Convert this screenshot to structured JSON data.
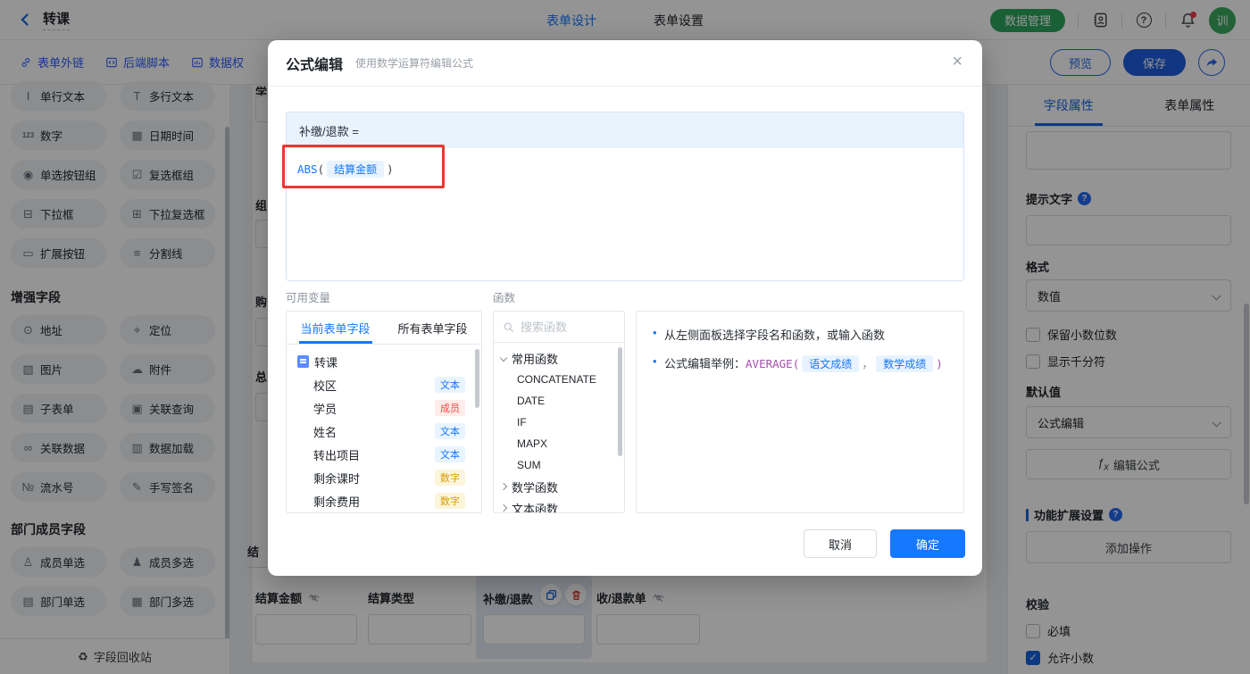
{
  "topbar": {
    "title": "转课",
    "tab_design": "表单设计",
    "tab_settings": "表单设置",
    "data_manage": "数据管理",
    "avatar": "训"
  },
  "toolbar": {
    "form_link": "表单外链",
    "backend_script": "后端脚本",
    "data_perm": "数据权",
    "preview": "预览",
    "save": "保存"
  },
  "sidebar": {
    "basic": [
      {
        "label": "单行文本"
      },
      {
        "label": "多行文本"
      },
      {
        "label": "数字"
      },
      {
        "label": "日期时间"
      },
      {
        "label": "单选按钮组"
      },
      {
        "label": "复选框组"
      },
      {
        "label": "下拉框"
      },
      {
        "label": "下拉复选框"
      },
      {
        "label": "扩展按钮"
      },
      {
        "label": "分割线"
      }
    ],
    "section_enhanced": "增强字段",
    "enhanced": [
      {
        "label": "地址"
      },
      {
        "label": "定位"
      },
      {
        "label": "图片"
      },
      {
        "label": "附件"
      },
      {
        "label": "子表单"
      },
      {
        "label": "关联查询"
      },
      {
        "label": "关联数据"
      },
      {
        "label": "数据加载"
      },
      {
        "label": "流水号"
      },
      {
        "label": "手写签名"
      }
    ],
    "section_dept": "部门成员字段",
    "dept": [
      {
        "label": "成员单选"
      },
      {
        "label": "成员多选"
      },
      {
        "label": "部门单选"
      },
      {
        "label": "部门多选"
      }
    ],
    "recycle": "字段回收站"
  },
  "canvas": {
    "fragments": {
      "f1": "学",
      "f2": "组",
      "f3": "购",
      "f4": "总",
      "f5": "结"
    },
    "fields": [
      {
        "label": "结算金额"
      },
      {
        "label": "结算类型"
      },
      {
        "label": "补缴/退款"
      },
      {
        "label": "收/退款单"
      }
    ]
  },
  "modal": {
    "title": "公式编辑",
    "subtitle": "使用数学运算符编辑公式",
    "target": "补缴/退款 =",
    "formula": {
      "fn": "ABS",
      "open": "(",
      "field": "结算金额",
      "close": ")"
    },
    "variables": {
      "label": "可用变量",
      "tab_current": "当前表单字段",
      "tab_all": "所有表单字段",
      "root": "转课",
      "fields": [
        {
          "name": "校区",
          "type": "文本"
        },
        {
          "name": "学员",
          "type": "成员"
        },
        {
          "name": "姓名",
          "type": "文本"
        },
        {
          "name": "转出项目",
          "type": "文本"
        },
        {
          "name": "剩余课时",
          "type": "数字"
        },
        {
          "name": "剩余费用",
          "type": "数字"
        }
      ]
    },
    "functions": {
      "label": "函数",
      "search_placeholder": "搜索函数",
      "group_common": "常用函数",
      "items": [
        "CONCATENATE",
        "DATE",
        "IF",
        "MAPX",
        "SUM"
      ],
      "group_math": "数学函数",
      "group_text": "文本函数"
    },
    "help": {
      "line1": "从左侧面板选择字段名和函数，或输入函数",
      "line2_prefix": "公式编辑举例：",
      "line2_fn": "AVERAGE(",
      "chip1": "语文成绩",
      "comma": "，",
      "chip2": "数学成绩",
      "close": ")"
    },
    "cancel": "取消",
    "ok": "确定"
  },
  "panel": {
    "tab_field": "字段属性",
    "tab_form": "表单属性",
    "hint_label": "提示文字",
    "format_label": "格式",
    "format_value": "数值",
    "cb_decimal": "保留小数位数",
    "cb_thousand": "显示千分符",
    "default_label": "默认值",
    "default_value": "公式编辑",
    "fx_button": "编辑公式",
    "ext_label": "功能扩展设置",
    "add_action": "添加操作",
    "validate": "校验",
    "cb_required": "必填",
    "cb_allow_decimal": "允许小数"
  },
  "colors": {
    "accent": "#1677ff",
    "green": "#2ba55d",
    "red": "#e8382f",
    "purple": "#a64db0",
    "badge_text_bg": "#e8f4ff",
    "badge_member_bg": "#ffece8",
    "badge_number_bg": "#fdf5d9"
  }
}
